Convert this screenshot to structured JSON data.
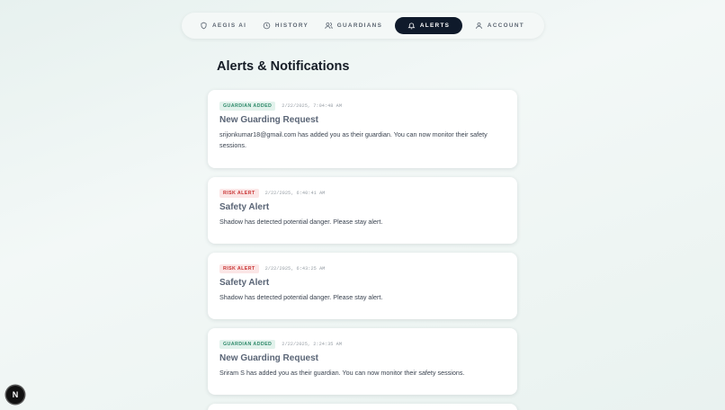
{
  "nav": {
    "items": [
      {
        "label": "AEGIS AI",
        "icon": "shield-icon",
        "active": false
      },
      {
        "label": "HISTORY",
        "icon": "clock-icon",
        "active": false
      },
      {
        "label": "GUARDIANS",
        "icon": "users-icon",
        "active": false
      },
      {
        "label": "ALERTS",
        "icon": "bell-icon",
        "active": true
      },
      {
        "label": "ACCOUNT",
        "icon": "user-icon",
        "active": false
      }
    ]
  },
  "page": {
    "title": "Alerts & Notifications"
  },
  "alerts": [
    {
      "badge": "GUARDIAN ADDED",
      "badge_color": "#2f8a6a",
      "time": "2/22/2025, 7:04:48 AM",
      "title": "New Guarding Request",
      "body": "srijonkumar18@gmail.com has added you as their guardian. You can now monitor their safety sessions."
    },
    {
      "badge": "RISK ALERT",
      "badge_color": "#c93434",
      "time": "2/22/2025, 6:40:41 AM",
      "title": "Safety Alert",
      "body": "Shadow has detected potential danger. Please stay alert."
    },
    {
      "badge": "RISK ALERT",
      "badge_color": "#c93434",
      "time": "2/22/2025, 6:43:25 AM",
      "title": "Safety Alert",
      "body": "Shadow has detected potential danger. Please stay alert."
    },
    {
      "badge": "GUARDIAN ADDED",
      "badge_color": "#2f8a6a",
      "time": "2/22/2025, 2:24:35 AM",
      "title": "New Guarding Request",
      "body": "Sriram S has added you as their guardian. You can now monitor their safety sessions."
    }
  ],
  "dev_indicator": {
    "label": "N"
  },
  "colors": {
    "accent": "#0f1a2b",
    "green": "#2f8a6a",
    "red": "#c93434"
  }
}
